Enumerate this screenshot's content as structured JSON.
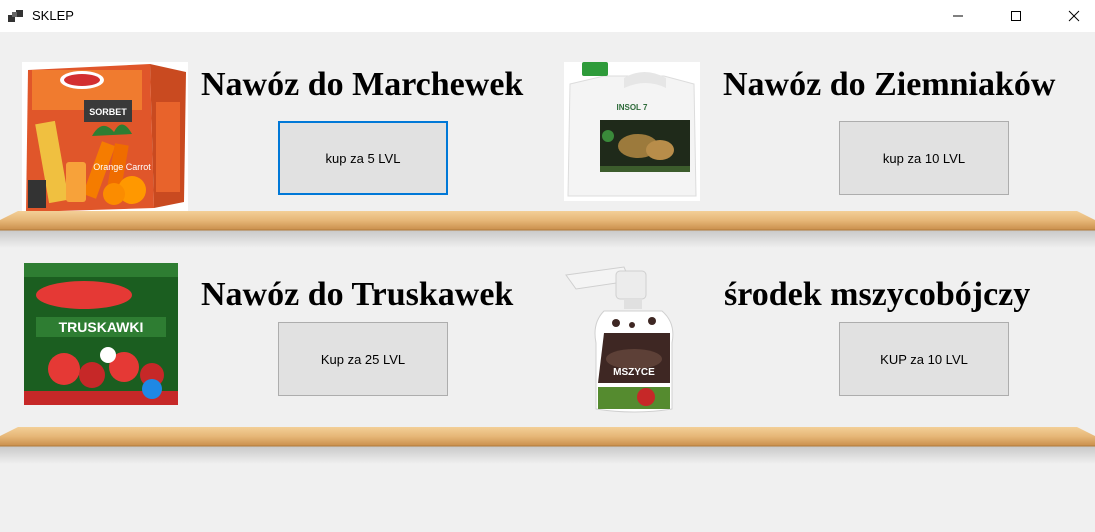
{
  "window": {
    "title": "SKLEP",
    "app_icon": "app-window-icon",
    "controls": {
      "minimize": "minimize-icon",
      "maximize": "maximize-icon",
      "close": "close-icon"
    }
  },
  "products": [
    {
      "title": "Nawóz do Marchewek",
      "button_label": "kup za 5 LVL",
      "image_text": "Orange Carrot"
    },
    {
      "title": "Nawóz do Ziemniaków",
      "button_label": "kup za 10 LVL",
      "image_text": "INSOL 7"
    },
    {
      "title": "Nawóz do Truskawek",
      "button_label": "Kup za 25 LVL",
      "image_text": "TRUSKAWKI"
    },
    {
      "title": "środek mszycobójczy",
      "button_label": "KUP za 10 LVL",
      "image_text": "MSZYCE"
    }
  ],
  "colors": {
    "background": "#f0f0f0",
    "button_face": "#e1e1e1",
    "button_border": "#adadad",
    "focus_border": "#0078d7",
    "shelf_wood": "#e8b87a"
  }
}
